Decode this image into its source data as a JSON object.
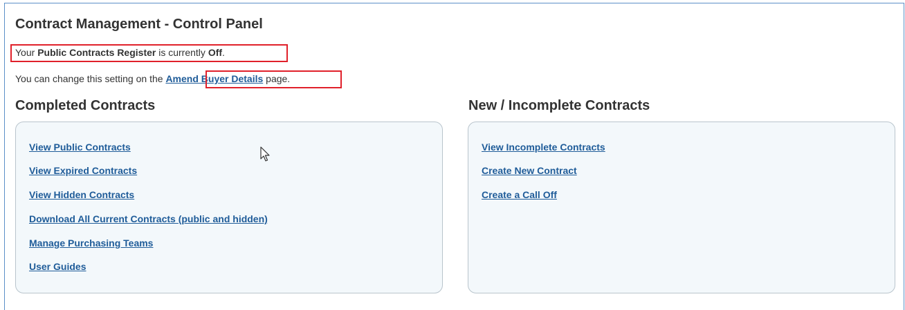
{
  "page": {
    "title": "Contract Management - Control Panel",
    "register_prefix": "Your ",
    "register_name": "Public Contracts Register",
    "register_middle": " is currently ",
    "register_status": "Off",
    "register_suffix": ".",
    "change_prefix": "You can change this setting on the ",
    "change_link": "Amend Buyer Details",
    "change_suffix": " page."
  },
  "completed": {
    "heading": "Completed Contracts",
    "links": [
      "View Public Contracts",
      "View Expired Contracts",
      "View Hidden Contracts",
      "Download All Current Contracts (public and hidden)",
      "Manage Purchasing Teams",
      "User Guides"
    ]
  },
  "incomplete": {
    "heading": "New / Incomplete Contracts",
    "links": [
      "View Incomplete Contracts",
      "Create New Contract",
      "Create a Call Off"
    ]
  },
  "colors": {
    "link": "#1f5c99",
    "highlight": "#e0202a",
    "frame": "#5b8fc7",
    "panel_bg": "#f3f8fb"
  }
}
